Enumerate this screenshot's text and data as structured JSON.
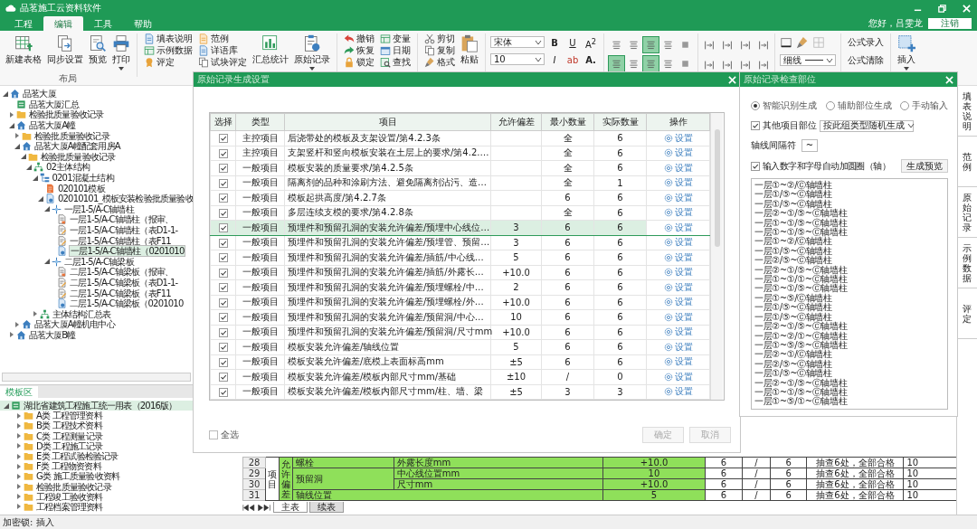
{
  "window": {
    "title": "品茗施工云资料软件",
    "greeting": "您好，吕雯龙",
    "logout": "注销"
  },
  "menu_tabs": [
    {
      "label": "工程",
      "selected": false
    },
    {
      "label": "编辑",
      "selected": true
    },
    {
      "label": "工具",
      "selected": false
    },
    {
      "label": "帮助",
      "selected": false
    }
  ],
  "ribbon": {
    "layout_buttons": [
      {
        "label": "新建表格",
        "dropdown": false
      },
      {
        "label": "同步设置",
        "dropdown": false
      },
      {
        "label": "预览",
        "dropdown": false
      },
      {
        "label": "打印",
        "dropdown": true
      }
    ],
    "layout_group": "布局",
    "small_col_1": [
      "填表说明",
      "示例数据",
      "评定"
    ],
    "small_col_2": [
      "范例",
      "详语库",
      "试块评定"
    ],
    "big_buttons": [
      {
        "label": "汇总统计",
        "dropdown": false
      },
      {
        "label": "原始记录",
        "dropdown": true
      }
    ],
    "edit_col_1": [
      "撤销",
      "恢复",
      "锁定"
    ],
    "edit_col_2": [
      "变量",
      "日期",
      "查找"
    ],
    "clip_col": [
      "剪切",
      "复制",
      "格式"
    ],
    "paste": "粘贴",
    "font": "宋体",
    "size": "10",
    "style_buttons": [
      "B",
      "U",
      "A$^{2}$",
      "I",
      "ab",
      "A."
    ],
    "align_buttons": [
      {
        "selected": false
      },
      {
        "selected": false
      },
      {
        "selected": true
      },
      {
        "selected": false
      },
      {
        "selected": false
      },
      {
        "selected": true
      },
      {
        "selected": false
      },
      {
        "selected": true
      },
      {
        "selected": false
      },
      {
        "selected": false
      }
    ],
    "line_style": "细线",
    "formula_buttons": [
      "公式录入",
      "公式清除"
    ],
    "insert": {
      "label": "插入",
      "dropdown": true
    }
  },
  "project_tree": [
    {
      "label": "品茗大厦",
      "kind": "house",
      "expanded": true,
      "selected": false,
      "children": [
        {
          "label": "品茗大厦汇总",
          "kind": "summary",
          "selected": false
        },
        {
          "label": "检验批质量验收记录",
          "kind": "folder",
          "expanded": false,
          "selected": false
        },
        {
          "label": "品茗大厦A幢",
          "kind": "house",
          "expanded": true,
          "selected": false,
          "children": [
            {
              "label": "检验批质量验收记录",
              "kind": "folder",
              "expanded": false,
              "selected": false
            },
            {
              "label": "品茗大厦A幢配套用房A",
              "kind": "house",
              "expanded": true,
              "selected": false,
              "children": [
                {
                  "label": "检验批质量验收记录",
                  "kind": "folder",
                  "expanded": true,
                  "selected": false,
                  "children": [
                    {
                      "label": "02主体结构",
                      "kind": "org",
                      "expanded": true,
                      "selected": false,
                      "children": [
                        {
                          "label": "0201混凝土结构",
                          "kind": "branch",
                          "expanded": true,
                          "selected": false,
                          "children": [
                            {
                              "label": "020101模板",
                              "kind": "doc",
                              "selected": false
                            },
                            {
                              "label": "02010101_模板安装检验批质量验收",
                              "kind": "check",
                              "expanded": true,
                              "selected": false,
                              "children": [
                                {
                                  "label": "一层1-5/A-C轴墙柱",
                                  "kind": "axis",
                                  "expanded": true,
                                  "selected": false,
                                  "children": [
                                    {
                                      "label": "一层1-5/A-C轴墙柱（报审、",
                                      "kind": "form",
                                      "selected": false
                                    },
                                    {
                                      "label": "一层1-5/A-C轴墙柱（表D1-1-",
                                      "kind": "edit",
                                      "selected": false
                                    },
                                    {
                                      "label": "一层1-5/A-C轴墙柱（表F11",
                                      "kind": "edit",
                                      "selected": false
                                    },
                                    {
                                      "label": "一层1-5/A-C轴墙柱（0201010",
                                      "kind": "check",
                                      "selected": true
                                    }
                                  ]
                                },
                                {
                                  "label": "二层1-5/A-C轴梁板",
                                  "kind": "axis",
                                  "expanded": true,
                                  "selected": false,
                                  "children": [
                                    {
                                      "label": "二层1-5/A-C轴梁板（报审、",
                                      "kind": "form",
                                      "selected": false
                                    },
                                    {
                                      "label": "二层1-5/A-C轴梁板（表D1-1-",
                                      "kind": "edit",
                                      "selected": false
                                    },
                                    {
                                      "label": "二层1-5/A-C轴梁板（表F11",
                                      "kind": "edit",
                                      "selected": false
                                    },
                                    {
                                      "label": "二层1-5/A-C轴梁板（0201010",
                                      "kind": "check",
                                      "selected": false
                                    }
                                  ]
                                }
                              ]
                            }
                          ]
                        },
                        {
                          "label": "主体结构汇总表",
                          "kind": "org",
                          "expanded": false,
                          "selected": false
                        }
                      ]
                    }
                  ]
                }
              ]
            },
            {
              "label": "品茗大厦A幢机电中心",
              "kind": "house",
              "expanded": false,
              "selected": false
            }
          ]
        },
        {
          "label": "品茗大厦B幢",
          "kind": "house",
          "expanded": false,
          "selected": false
        }
      ]
    }
  ],
  "template_pane": {
    "title": "模板区",
    "tree": [
      {
        "label": "湖北省建筑工程施工统一用表（2016版）",
        "kind": "summary",
        "expanded": true,
        "selected": true,
        "children": [
          {
            "label": "A类 工程管理资料",
            "kind": "folder",
            "expanded": false,
            "selected": false
          },
          {
            "label": "B类 工程技术资料",
            "kind": "folder",
            "expanded": false,
            "selected": false
          },
          {
            "label": "C类 工程测量记录",
            "kind": "folder",
            "expanded": false,
            "selected": false
          },
          {
            "label": "D类 工程施工记录",
            "kind": "folder",
            "expanded": false,
            "selected": false
          },
          {
            "label": "E类 工程试验检验记录",
            "kind": "folder",
            "expanded": false,
            "selected": false
          },
          {
            "label": "F类 工程物资资料",
            "kind": "folder",
            "expanded": false,
            "selected": false
          },
          {
            "label": "G类 施工质量验收资料",
            "kind": "folder",
            "expanded": false,
            "selected": false
          },
          {
            "label": "检验批质量验收记录",
            "kind": "folder",
            "expanded": false,
            "selected": false
          },
          {
            "label": "工程竣工验收资料",
            "kind": "folder",
            "expanded": false,
            "selected": false
          },
          {
            "label": "工程档案管理资料",
            "kind": "folder",
            "expanded": false,
            "selected": false
          }
        ]
      }
    ]
  },
  "sheet": {
    "group": "项目",
    "category": "允许偏差",
    "rows": [
      {
        "num": "28",
        "kind": "single",
        "sub": "螺栓",
        "item": "外露长度mm",
        "value": "+10.0",
        "min": "6",
        "sep": "/",
        "actual": "6",
        "result": "抽查6处，全部合格",
        "rate": "10"
      },
      {
        "num": "29",
        "kind": "group-first",
        "sub": "预留洞",
        "item": "中心线位置mm",
        "value": "10",
        "min": "6",
        "sep": "/",
        "actual": "6",
        "result": "抽查6处，全部合格",
        "rate": "10"
      },
      {
        "num": "30",
        "kind": "group-next",
        "item": "尺寸mm",
        "value": "+10.0",
        "min": "6",
        "sep": "/",
        "actual": "6",
        "result": "抽查6处，全部合格",
        "rate": "10"
      },
      {
        "num": "31",
        "kind": "wide",
        "item": "轴线位置",
        "value": "5",
        "min": "6",
        "sep": "/",
        "actual": "6",
        "result": "抽查6处，全部合格",
        "rate": "10"
      }
    ],
    "tabs": [
      {
        "label": "主表",
        "selected": true
      },
      {
        "label": "续表",
        "selected": false
      }
    ]
  },
  "record_dialog": {
    "title": "原始记录生成设置",
    "columns": [
      "选择",
      "类型",
      "项目",
      "允许偏差",
      "最小数量",
      "实际数量",
      "操作"
    ],
    "rows": [
      {
        "checked": true,
        "selected": false,
        "type": "主控项目",
        "item": "后浇带处的模板及支架设置/第4.2.3条",
        "min": "全",
        "actual": "6",
        "action": "设置"
      },
      {
        "checked": true,
        "selected": false,
        "type": "主控项目",
        "item": "支架竖杆和竖向模板安装在土层上的要求/第4.2.…",
        "min": "全",
        "actual": "6",
        "action": "设置"
      },
      {
        "checked": true,
        "selected": false,
        "type": "一般项目",
        "item": "模板安装的质量要求/第4.2.5条",
        "min": "全",
        "actual": "6",
        "action": "设置"
      },
      {
        "checked": true,
        "selected": false,
        "type": "一般项目",
        "item": "隔离剂的品种和涂刷方法、避免隔离剂沾污、造…",
        "min": "全",
        "actual": "1",
        "action": "设置"
      },
      {
        "checked": true,
        "selected": false,
        "type": "一般项目",
        "item": "模板起拱高度/第4.2.7条",
        "min": "6",
        "actual": "6",
        "action": "设置"
      },
      {
        "checked": true,
        "selected": false,
        "type": "一般项目",
        "item": "多层连续支模的要求/第4.2.8条",
        "min": "全",
        "actual": "6",
        "action": "设置"
      },
      {
        "checked": true,
        "selected": true,
        "type": "一般项目",
        "item": "预埋件和预留孔洞的安装允许偏差/预埋中心线位…",
        "deviation": "3",
        "min": "6",
        "actual": "6",
        "action": "设置"
      },
      {
        "checked": true,
        "selected": false,
        "type": "一般项目",
        "item": "预埋件和预留孔洞的安装允许偏差/预埋管、预留…",
        "deviation": "3",
        "min": "6",
        "actual": "6",
        "action": "设置"
      },
      {
        "checked": true,
        "selected": false,
        "type": "一般项目",
        "item": "预埋件和预留孔洞的安装允许偏差/插筋/中心线…",
        "deviation": "5",
        "min": "6",
        "actual": "6",
        "action": "设置"
      },
      {
        "checked": true,
        "selected": false,
        "type": "一般项目",
        "item": "预埋件和预留孔洞的安装允许偏差/插筋/外露长…",
        "deviation": "+10.0",
        "min": "6",
        "actual": "6",
        "action": "设置"
      },
      {
        "checked": true,
        "selected": false,
        "type": "一般项目",
        "item": "预埋件和预留孔洞的安装允许偏差/预埋螺栓/中…",
        "deviation": "2",
        "min": "6",
        "actual": "6",
        "action": "设置"
      },
      {
        "checked": true,
        "selected": false,
        "type": "一般项目",
        "item": "预埋件和预留孔洞的安装允许偏差/预埋螺栓/外…",
        "deviation": "+10.0",
        "min": "6",
        "actual": "6",
        "action": "设置"
      },
      {
        "checked": true,
        "selected": false,
        "type": "一般项目",
        "item": "预埋件和预留孔洞的安装允许偏差/预留洞/中心…",
        "deviation": "10",
        "min": "6",
        "actual": "6",
        "action": "设置"
      },
      {
        "checked": true,
        "selected": false,
        "type": "一般项目",
        "item": "预埋件和预留孔洞的安装允许偏差/预留洞/尺寸mm",
        "deviation": "+10.0",
        "min": "6",
        "actual": "6",
        "action": "设置"
      },
      {
        "checked": true,
        "selected": false,
        "type": "一般项目",
        "item": "模板安装允许偏差/轴线位置",
        "deviation": "5",
        "min": "6",
        "actual": "6",
        "action": "设置"
      },
      {
        "checked": true,
        "selected": false,
        "type": "一般项目",
        "item": "模板安装允许偏差/底模上表面标高mm",
        "deviation": "±5",
        "min": "6",
        "actual": "6",
        "action": "设置"
      },
      {
        "checked": true,
        "selected": false,
        "type": "一般项目",
        "item": "模板安装允许偏差/模板内部尺寸mm/基础",
        "deviation": "±10",
        "min": "/",
        "actual": "0",
        "action": "设置"
      },
      {
        "checked": true,
        "selected": false,
        "type": "一般项目",
        "item": "模板安装允许偏差/模板内部尺寸mm/柱、墙、梁",
        "deviation": "±5",
        "min": "3",
        "actual": "3",
        "action": "设置"
      }
    ],
    "select_all": {
      "label": "全选",
      "checked": false
    },
    "buttons": [
      "确定",
      "取消"
    ]
  },
  "position_dialog": {
    "title": "原始记录检查部位",
    "modes": [
      {
        "label": "智能识别生成",
        "selected": true
      },
      {
        "label": "辅助部位生成",
        "selected": false
      },
      {
        "label": "手动输入",
        "selected": false
      }
    ],
    "other_parts": {
      "label": "其他项目部位",
      "checked": true,
      "value": "按此组类型随机生成"
    },
    "separator": {
      "label": "轴线间隔符",
      "value": "~"
    },
    "auto_circle": {
      "label": "输入数字和字母自动加圆圈（轴）",
      "checked": true
    },
    "preview_button": "生成预览",
    "lines": [
      "一层①~②/Ⓒ轴墙柱",
      "一层①/⑤~Ⓒ轴墙柱",
      "一层①/⑤~Ⓒ轴墙柱",
      "一层②~①/⑤~Ⓒ轴墙柱",
      "一层①~①/⑤~Ⓒ轴墙柱",
      "一层①~①/⑤~Ⓒ轴墙柱",
      "一层①~②/Ⓒ轴墙柱",
      "一层①/⑤~Ⓒ轴墙柱",
      "一层②/⑤~Ⓒ轴墙柱",
      "一层②~①/⑤~Ⓒ轴墙柱",
      "一层①~①/①~Ⓒ轴墙柱",
      "一层①~①/⑤~Ⓒ轴墙柱",
      "一层①~⑤/Ⓒ轴墙柱",
      "一层①/⑤~Ⓒ轴墙柱",
      "一层①/⑤~Ⓒ轴墙柱",
      "一层②~①/⑤~Ⓒ轴墙柱",
      "一层①~②/①~Ⓒ轴墙柱",
      "一层①~⑤/⑤~Ⓒ轴墙柱",
      "一层②~①/Ⓒ轴墙柱",
      "一层②/⑤~Ⓒ轴墙柱",
      "一层①/⑤~Ⓒ轴墙柱",
      "一层②~①/⑤~Ⓒ轴墙柱",
      "一层①~①/⑤~Ⓒ轴墙柱",
      "一层①~⑤/①~Ⓒ轴墙柱"
    ]
  },
  "side_tabs": [
    {
      "label": "填表说明",
      "selected": false
    },
    {
      "label": "范例",
      "selected": false
    },
    {
      "label": "原始记录",
      "selected": false
    },
    {
      "label": "示例数据",
      "selected": false
    },
    {
      "label": "评定",
      "selected": false
    }
  ],
  "status_bar": "加密锁: 插入"
}
